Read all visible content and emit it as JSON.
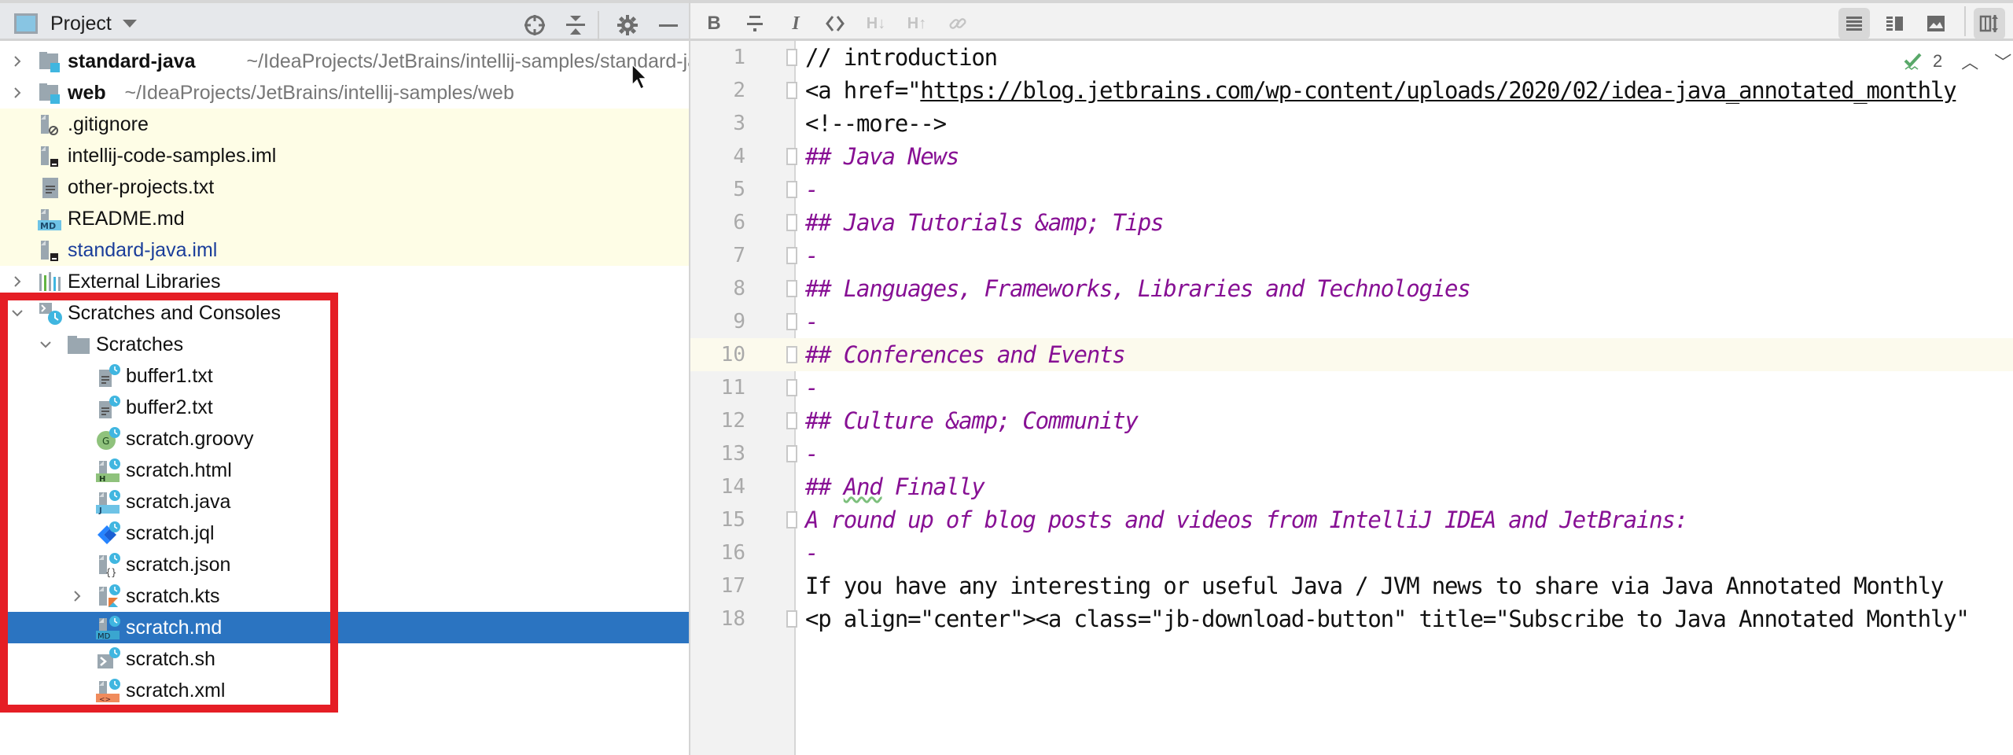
{
  "project_panel": {
    "title": "Project",
    "toolbar": [
      {
        "name": "locate-icon",
        "glyph": "crosshair"
      },
      {
        "name": "collapse-all-icon",
        "glyph": "collapse"
      },
      {
        "name": "gear-icon",
        "glyph": "gear"
      },
      {
        "name": "hide-icon",
        "glyph": "minus"
      }
    ],
    "tree": [
      {
        "label": "standard-java",
        "path": "~/IdeaProjects/JetBrains/intellij-samples/standard-java",
        "icon": "module-folder-icon",
        "chevron": "right",
        "bold": true
      },
      {
        "label": "web",
        "path": "~/IdeaProjects/JetBrains/intellij-samples/web",
        "icon": "module-folder-icon",
        "chevron": "right",
        "bold": true
      },
      {
        "label": ".gitignore",
        "icon": "ignore-file-icon"
      },
      {
        "label": "intellij-code-samples.iml",
        "icon": "iml-file-icon"
      },
      {
        "label": "other-projects.txt",
        "icon": "text-file-icon"
      },
      {
        "label": "README.md",
        "icon": "markdown-file-icon"
      },
      {
        "label": "standard-java.iml",
        "icon": "iml-file-icon",
        "modified": true
      },
      {
        "label": "External Libraries",
        "icon": "libraries-icon",
        "chevron": "right"
      },
      {
        "label": "Scratches and Consoles",
        "icon": "scratches-icon",
        "chevron": "down"
      },
      {
        "label": "Scratches",
        "icon": "folder-icon",
        "chevron": "down"
      },
      {
        "label": "buffer1.txt",
        "icon": "text-scratch-icon"
      },
      {
        "label": "buffer2.txt",
        "icon": "text-scratch-icon"
      },
      {
        "label": "scratch.groovy",
        "icon": "groovy-scratch-icon"
      },
      {
        "label": "scratch.html",
        "icon": "html-scratch-icon"
      },
      {
        "label": "scratch.java",
        "icon": "java-scratch-icon"
      },
      {
        "label": "scratch.jql",
        "icon": "jql-scratch-icon"
      },
      {
        "label": "scratch.json",
        "icon": "json-scratch-icon"
      },
      {
        "label": "scratch.kts",
        "icon": "kotlin-scratch-icon",
        "chevron": "right"
      },
      {
        "label": "scratch.md",
        "icon": "markdown-scratch-icon",
        "selected": true
      },
      {
        "label": "scratch.sh",
        "icon": "shell-scratch-icon"
      },
      {
        "label": "scratch.xml",
        "icon": "xml-scratch-icon"
      }
    ]
  },
  "editor_toolbar": {
    "left": [
      {
        "name": "bold-button",
        "glyph": "B",
        "enabled": true
      },
      {
        "name": "strikethrough-button",
        "glyph": "S",
        "enabled": true
      },
      {
        "name": "italic-button",
        "glyph": "I",
        "enabled": true
      },
      {
        "name": "code-button",
        "glyph": "<>",
        "enabled": true
      },
      {
        "name": "header-down-button",
        "glyph": "H↓",
        "enabled": false
      },
      {
        "name": "header-up-button",
        "glyph": "H↑",
        "enabled": false
      },
      {
        "name": "link-button",
        "glyph": "link",
        "enabled": false
      }
    ],
    "right": [
      {
        "name": "editor-only-button",
        "active": true
      },
      {
        "name": "editor-and-preview-button",
        "active": false
      },
      {
        "name": "preview-only-button",
        "active": false
      },
      {
        "name": "sync-scroll-button",
        "active": true
      }
    ]
  },
  "inspections": {
    "count": "2"
  },
  "editor": {
    "current_line": 10,
    "lines": [
      {
        "n": "1",
        "text": "// introduction",
        "style": "plain",
        "fold": "start"
      },
      {
        "n": "2",
        "pre": "<a href=\"",
        "link": "https://blog.jetbrains.com/wp-content/uploads/2020/02/idea-java_annotated_monthly",
        "style": "link",
        "fold": "end"
      },
      {
        "n": "3",
        "text": "<!--more-->",
        "style": "plain"
      },
      {
        "n": "4",
        "text": "## Java News",
        "style": "heading",
        "fold": "start"
      },
      {
        "n": "5",
        "text": "-",
        "style": "heading",
        "fold": "end"
      },
      {
        "n": "6",
        "text": "## Java Tutorials &amp; Tips",
        "style": "heading",
        "fold": "start"
      },
      {
        "n": "7",
        "text": "-",
        "style": "heading",
        "fold": "end"
      },
      {
        "n": "8",
        "text": "## Languages, Frameworks, Libraries and Technologies",
        "style": "heading",
        "fold": "start"
      },
      {
        "n": "9",
        "text": "-",
        "style": "heading",
        "fold": "end"
      },
      {
        "n": "10",
        "text": "## Conferences and Events",
        "style": "heading",
        "fold": "start"
      },
      {
        "n": "11",
        "text": "-",
        "style": "heading",
        "fold": "end"
      },
      {
        "n": "12",
        "text": "## Culture &amp; Community",
        "style": "heading",
        "fold": "start"
      },
      {
        "n": "13",
        "text": "-",
        "style": "heading",
        "fold": "end"
      },
      {
        "n": "14",
        "pre": "## ",
        "typo": "And",
        "post": " Finally",
        "style": "heading-typo"
      },
      {
        "n": "15",
        "text": "A round up of blog posts and videos from IntelliJ IDEA and JetBrains:",
        "style": "heading",
        "fold": "start"
      },
      {
        "n": "16",
        "text": "-",
        "style": "heading"
      },
      {
        "n": "17",
        "text": "If you have any interesting or useful Java / JVM news to share via Java Annotated Monthly",
        "style": "plain"
      },
      {
        "n": "18",
        "text": "<p align=\"center\"><a class=\"jb-download-button\" title=\"Subscribe to Java Annotated Monthly\"",
        "style": "plain",
        "fold": "end"
      }
    ]
  },
  "highlight_box_color": "#e51e25",
  "selection_color": "#2b74c1"
}
